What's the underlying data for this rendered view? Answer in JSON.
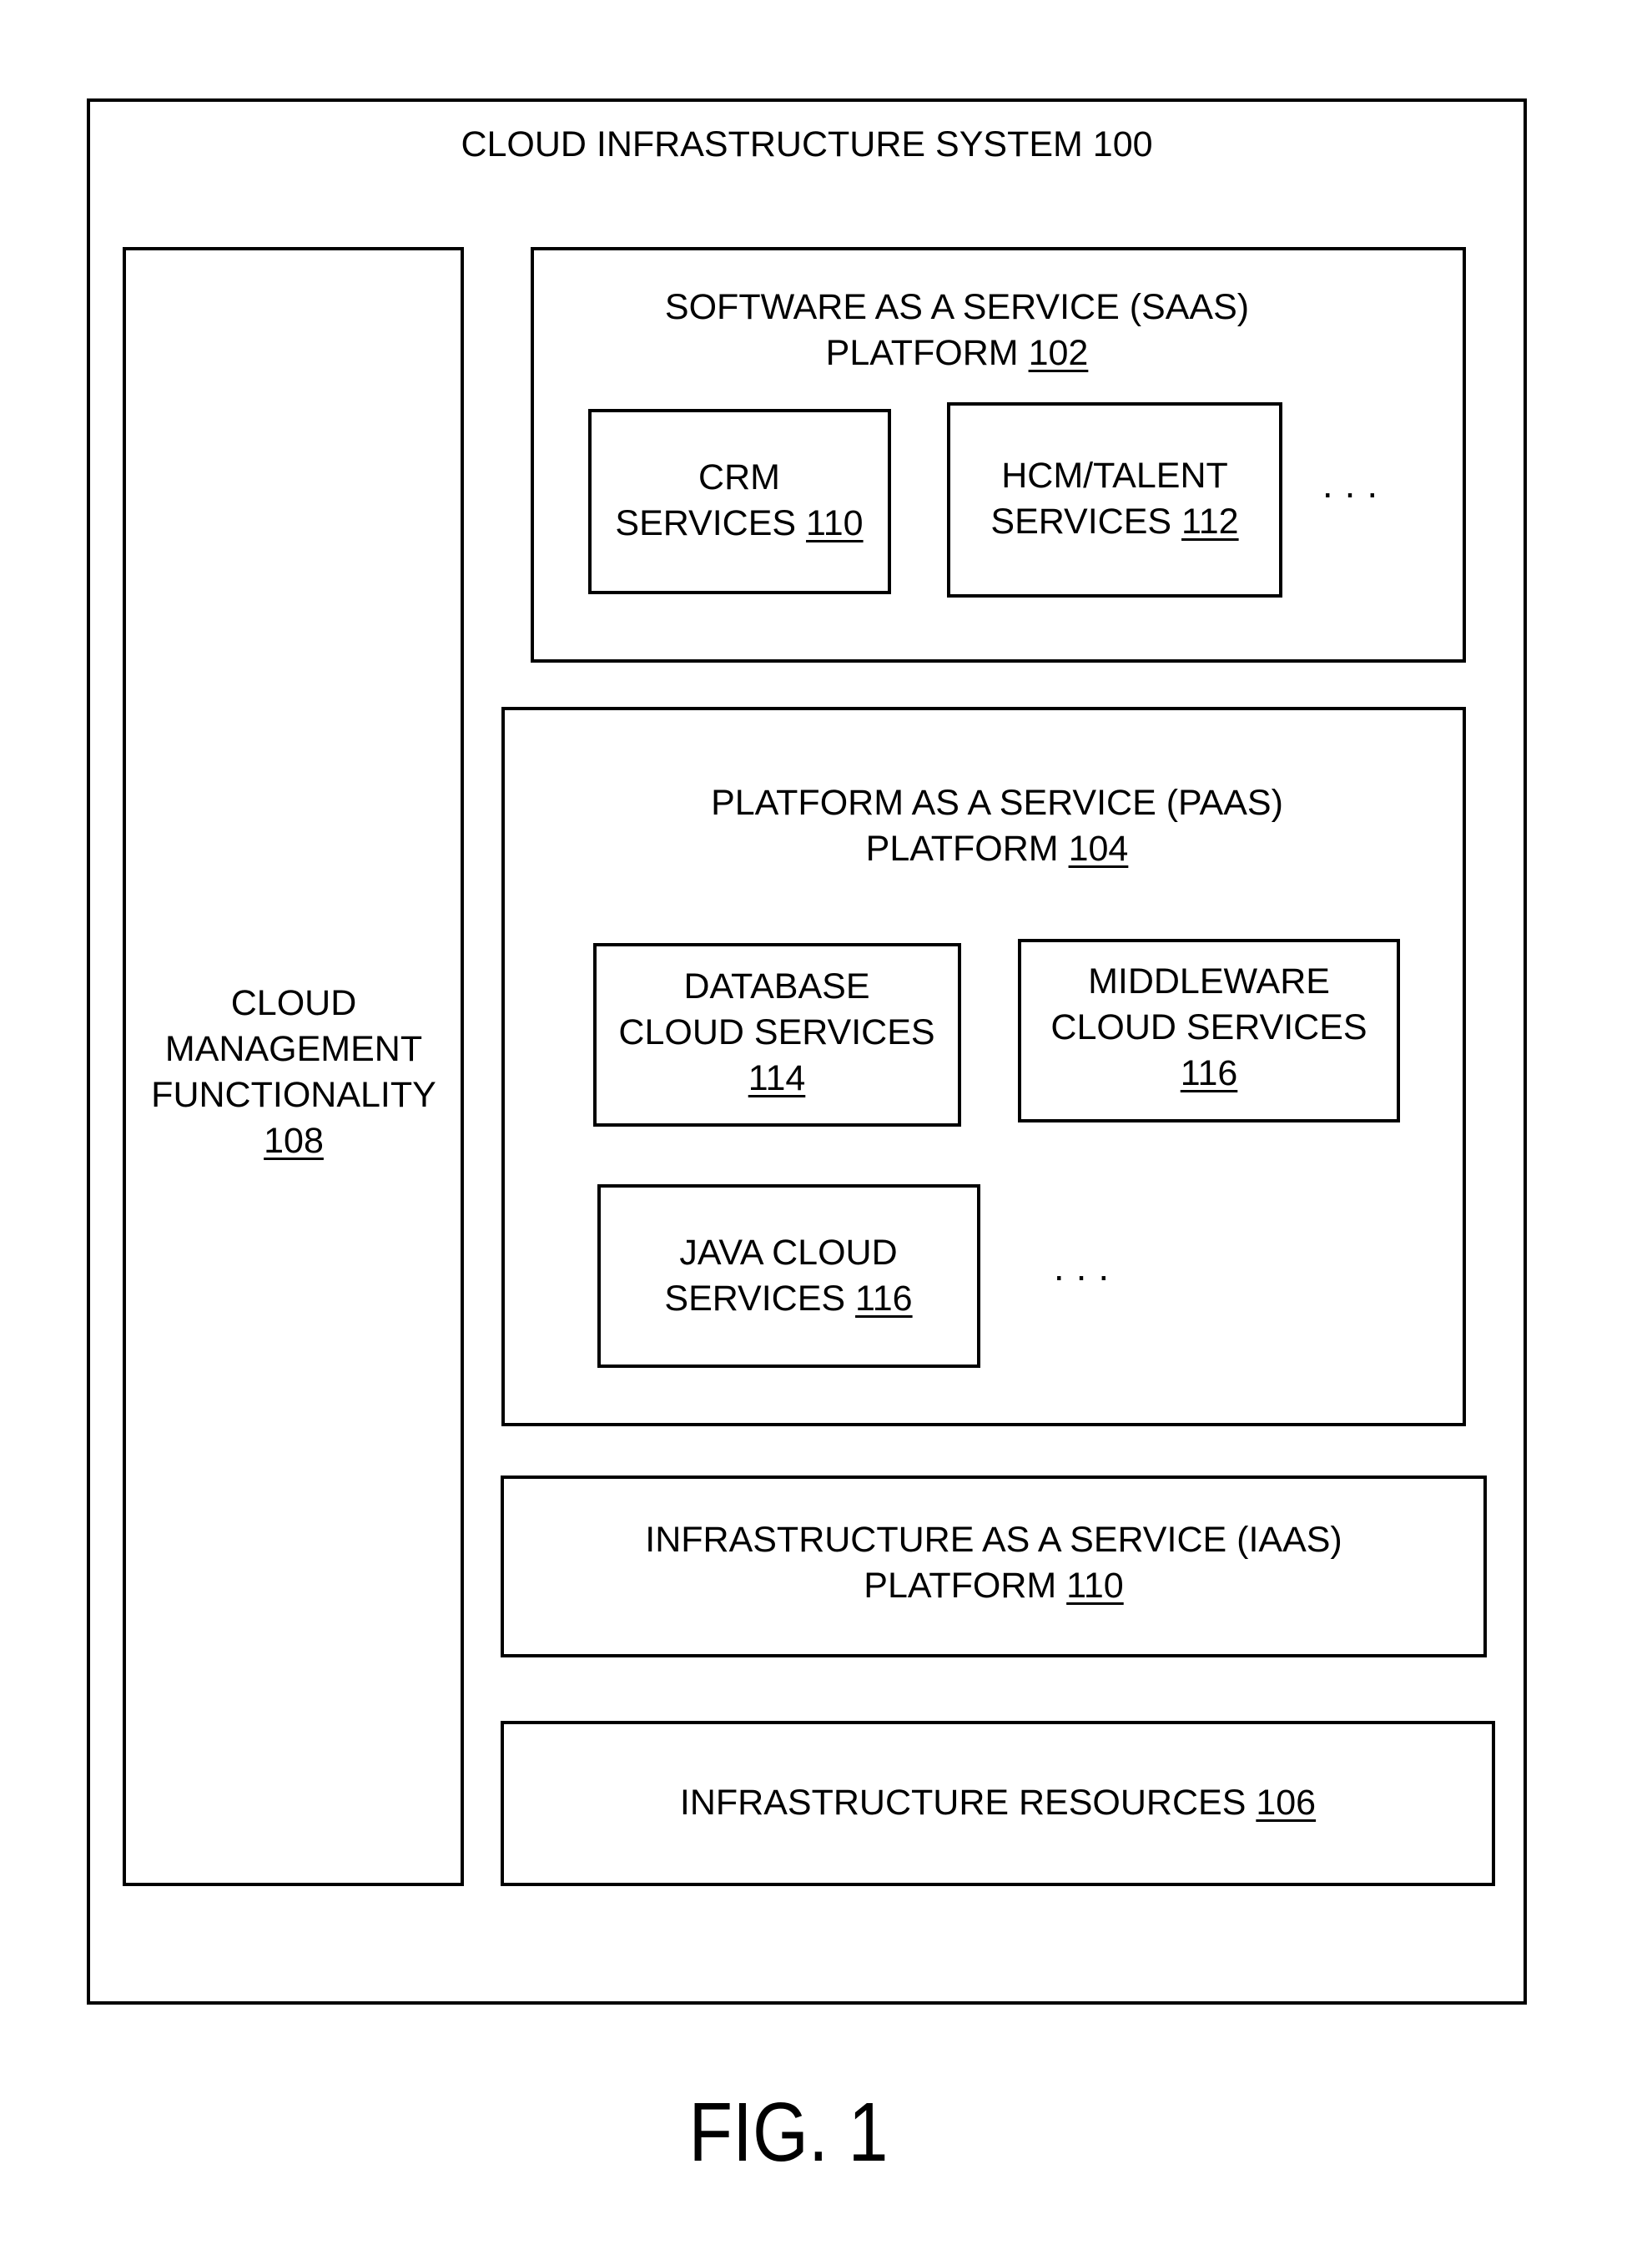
{
  "figure_label": "FIG. 1",
  "system": {
    "title": "CLOUD INFRASTRUCTURE SYSTEM",
    "ref": "100"
  },
  "management": {
    "lines": [
      "CLOUD",
      "MANAGEMENT",
      "FUNCTIONALITY"
    ],
    "ref": "108"
  },
  "saas": {
    "line1": "SOFTWARE AS A SERVICE (SAAS)",
    "line2": "PLATFORM",
    "ref": "102",
    "services": [
      {
        "line1": "CRM",
        "line2": "SERVICES",
        "ref": "110"
      },
      {
        "line1": "HCM/TALENT",
        "line2": "SERVICES",
        "ref": "112"
      }
    ],
    "ellipsis": "..."
  },
  "paas": {
    "line1": "PLATFORM AS A SERVICE (PAAS)",
    "line2": "PLATFORM",
    "ref": "104",
    "services": [
      {
        "line1": "DATABASE",
        "line2": "CLOUD SERVICES",
        "ref": "114"
      },
      {
        "line1": "MIDDLEWARE",
        "line2": "CLOUD SERVICES",
        "ref": "116"
      },
      {
        "line1": "JAVA CLOUD",
        "line2": "SERVICES",
        "ref": "116"
      }
    ],
    "ellipsis": "..."
  },
  "iaas": {
    "line1": "INFRASTRUCTURE AS A SERVICE (IAAS)",
    "line2": "PLATFORM",
    "ref": "110"
  },
  "resources": {
    "label": "INFRASTRUCTURE RESOURCES",
    "ref": "106"
  }
}
